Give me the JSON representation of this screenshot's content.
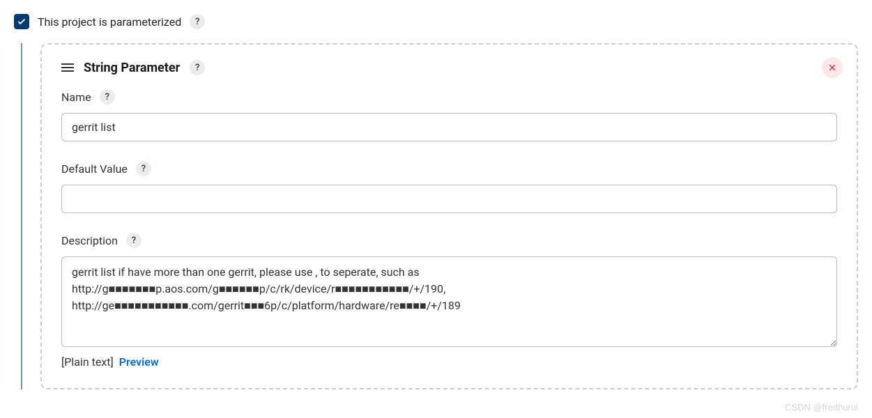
{
  "parameterized": {
    "label": "This project is parameterized",
    "checked": true
  },
  "parameter": {
    "title": "String Parameter",
    "name": {
      "label": "Name",
      "value": "gerrit list"
    },
    "defaultValue": {
      "label": "Default Value",
      "value": ""
    },
    "description": {
      "label": "Description",
      "value": "gerrit list if have more than one gerrit, please use , to seperate, such as\nhttp://g■■■■■■■p.aos.com/g■■■■■■p/c/rk/device/r■■■■■■■■■■■/+/190,\nhttp://ge■■■■■■■■■■■.com/gerrit■■■6p/c/platform/hardware/re■■■■/+/189"
    },
    "format": {
      "current": "[Plain text]",
      "preview": "Preview"
    }
  },
  "watermark": "CSDN @fredhurui"
}
